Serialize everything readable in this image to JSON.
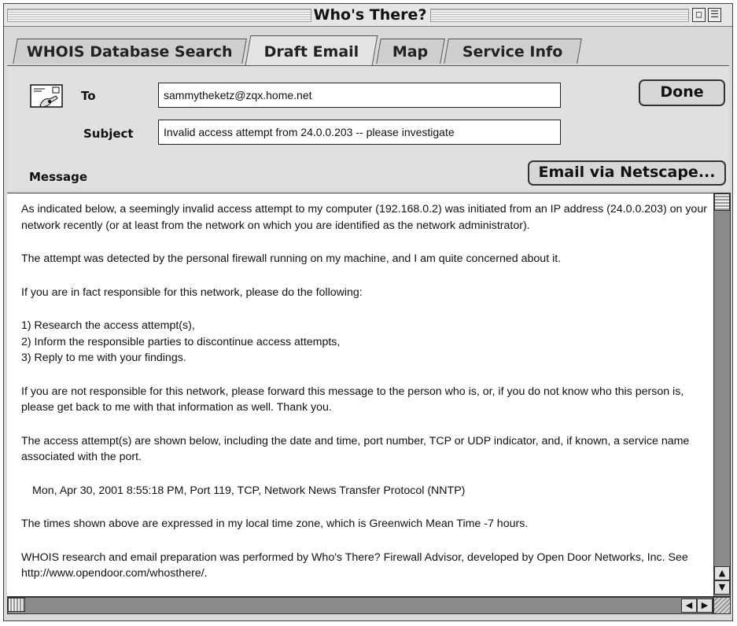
{
  "window": {
    "title": "Who's There?",
    "zoom_icon": "□",
    "collapse_icon": "☰"
  },
  "tabs": [
    {
      "label": "WHOIS Database Search"
    },
    {
      "label": "Draft Email"
    },
    {
      "label": "Map"
    },
    {
      "label": "Service Info"
    }
  ],
  "email": {
    "to_label": "To",
    "to_value": "sammytheketz@zqx.home.net",
    "subject_label": "Subject",
    "subject_value": "Invalid access attempt from 24.0.0.203 -- please investigate",
    "message_label": "Message",
    "done_label": "Done",
    "netscape_label": "Email via Netscape..."
  },
  "message": {
    "paragraphs": [
      "As indicated below, a seemingly invalid access attempt to my computer (192.168.0.2) was initiated from an IP address (24.0.0.203) on your network recently (or at least from the network on which you are identified as the network administrator).",
      "The attempt was detected by the personal firewall running on my machine, and I am quite concerned about it.",
      "If you are in fact responsible for this network, please do the following:",
      "1) Research the access attempt(s),",
      "2) Inform the responsible parties to discontinue access attempts,",
      "3) Reply to me with your findings.",
      "If you are not responsible for this network, please forward this message to the person who is, or, if you do not know who this person is, please get back to me with that information as well.  Thank you.",
      "The access attempt(s) are shown below, including the date and time, port number, TCP or UDP indicator, and, if known, a service name associated with the port.",
      "Mon, Apr 30, 2001 8:55:18 PM, Port 119, TCP, Network News Transfer Protocol (NNTP)",
      "The times shown above are expressed in my local time zone, which is Greenwich Mean Time -7 hours.",
      "WHOIS research and email preparation was performed by Who's There? Firewall Advisor, developed by Open Door Networks, Inc.  See http://www.opendoor.com/whosthere/."
    ]
  },
  "icons": {
    "email_icon": "envelope-hand-icon",
    "scroll_up": "▲",
    "scroll_down": "▼",
    "scroll_left": "◀",
    "scroll_right": "▶"
  }
}
